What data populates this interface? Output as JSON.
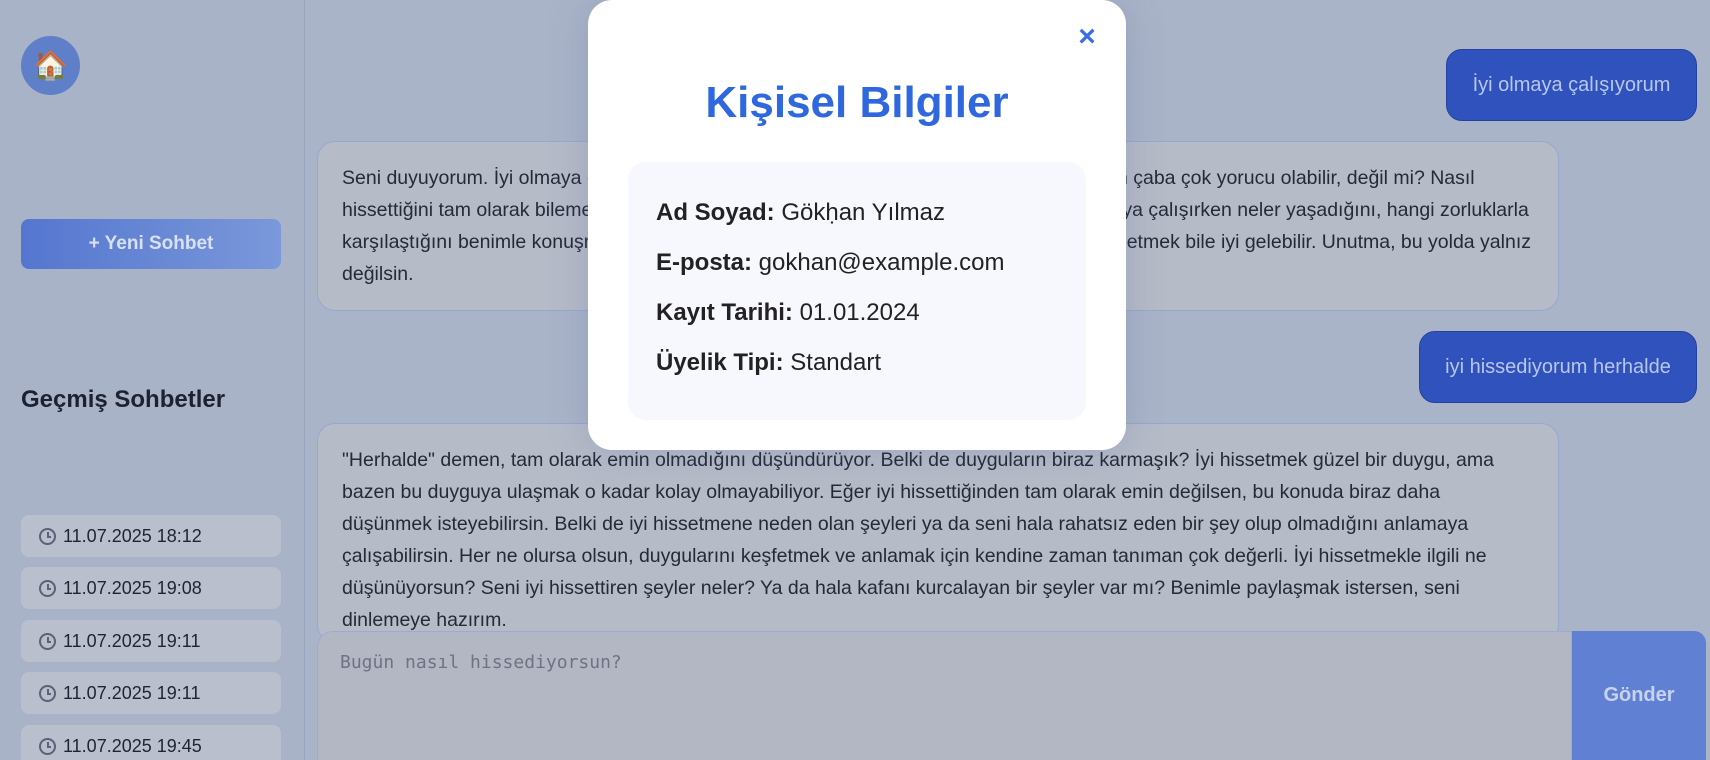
{
  "sidebar": {
    "home_icon": "🏠",
    "new_chat_label": "+ Yeni Sohbet",
    "history_title": "Geçmiş Sohbetler",
    "history": [
      "11.07.2025 18:12",
      "11.07.2025 19:08",
      "11.07.2025 19:11",
      "11.07.2025 19:11",
      "11.07.2025 19:45"
    ]
  },
  "chat": {
    "messages": [
      {
        "role": "user",
        "text": "İyi olmaya çalışıyorum"
      },
      {
        "role": "bot",
        "text": "Seni duyuyorum. İyi olmaya çalışmak bazen gerçekten zor olabilir ve bu süreçte harcadığın çaba çok yorucu olabilir, değil mi? Nasıl hissettiğini tam olarak bilemem ama bunu benimle paylaşmak istersen buradayım. İyi olmaya çalışırken neler yaşadığını, hangi zorluklarla karşılaştığını benimle konuşmak ister misin? Bazen sadece içini dökmek, duygularını ifade etmek bile iyi gelebilir. Unutma, bu yolda yalnız değilsin."
      },
      {
        "role": "user",
        "text": "iyi hissediyorum herhalde"
      },
      {
        "role": "bot",
        "text": "\"Herhalde\" demen, tam olarak emin olmadığını düşündürüyor. Belki de duyguların biraz karmaşık? İyi hissetmek güzel bir duygu, ama bazen bu duyguya ulaşmak o kadar kolay olmayabiliyor. Eğer iyi hissettiğinden tam olarak emin değilsen, bu konuda biraz daha düşünmek isteyebilirsin. Belki de iyi hissetmene neden olan şeyleri ya da seni hala rahatsız eden bir şey olup olmadığını anlamaya çalışabilirsin. Her ne olursa olsun, duygularını keşfetmek ve anlamak için kendine zaman tanıman çok değerli. İyi hissetmekle ilgili ne düşünüyorsun? Seni iyi hissettiren şeyler neler? Ya da hala kafanı kurcalayan bir şeyler var mı? Benimle paylaşmak istersen, seni dinlemeye hazırım."
      }
    ],
    "input_placeholder": "Bugün nasıl hissediyorsun?",
    "send_label": "Gönder"
  },
  "modal": {
    "close_icon": "×",
    "title": "Kişisel Bilgiler",
    "fields": [
      {
        "label": "Ad Soyad:",
        "value": "Gökḥan Yılmaz"
      },
      {
        "label": "E-posta:",
        "value": "gokhan@example.com"
      },
      {
        "label": "Kayıt Tarihi:",
        "value": "01.01.2024"
      },
      {
        "label": "Üyelik Tipi:",
        "value": "Standart"
      }
    ]
  },
  "colors": {
    "accent": "#2f68de",
    "user_bubble": "#2f52bd",
    "send_button": "#5f80d3"
  }
}
